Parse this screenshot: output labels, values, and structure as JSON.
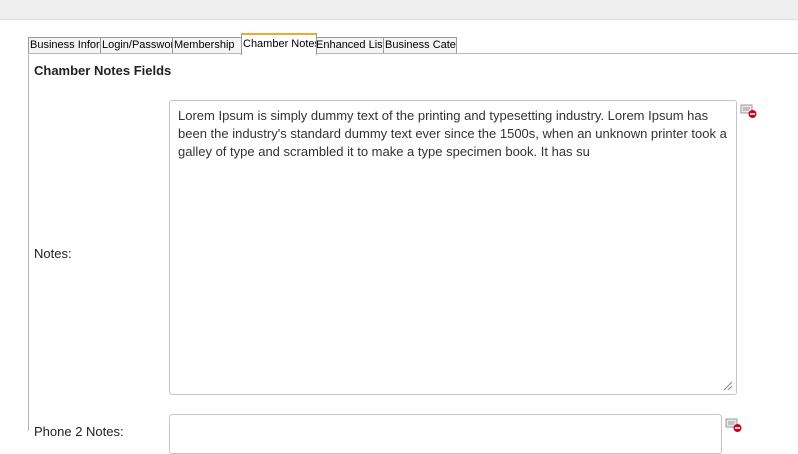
{
  "tabs": [
    {
      "label": "Business Information"
    },
    {
      "label": "Login/Password"
    },
    {
      "label": "Membership"
    },
    {
      "label": "Chamber Notes"
    },
    {
      "label": "Enhanced Listing"
    },
    {
      "label": "Business Categories"
    }
  ],
  "section": {
    "title": "Chamber Notes Fields"
  },
  "fields": {
    "notes": {
      "label": "Notes:",
      "value": "Lorem Ipsum is simply dummy text of the printing and typesetting industry. Lorem Ipsum has been the industry's standard dummy text ever since the 1500s, when an unknown printer took a galley of type and scrambled it to make a type specimen book. It has su"
    },
    "second": {
      "label": "Phone 2 Notes:",
      "value": ""
    }
  },
  "icons": {
    "clear": "clear-field-icon"
  },
  "colors": {
    "active_tab_accent": "#f0a830",
    "clear_icon_red": "#d0021b"
  }
}
